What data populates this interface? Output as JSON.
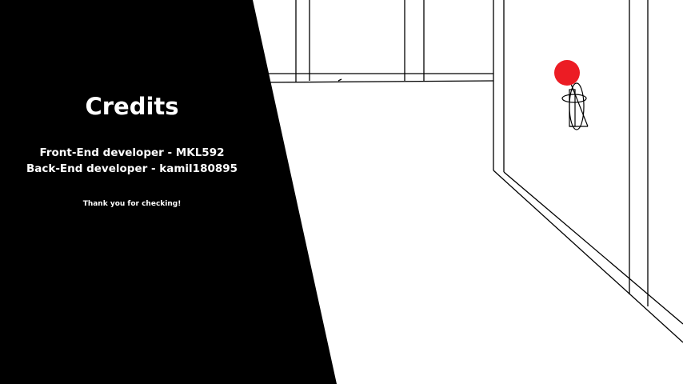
{
  "credits": {
    "title": "Credits",
    "lines": [
      "Front-End developer  -  MKL592",
      "Back-End developer  -  kamil180895"
    ],
    "thanks": "Thank you for checking!"
  },
  "colors": {
    "background": "#ffffff",
    "panel": "#000000",
    "text": "#ffffff",
    "line": "#000000",
    "target_dot": "#ec1c24"
  },
  "scene": {
    "target_icon": "red-dot-icon",
    "figure_icon": "wireframe-figure-icon"
  }
}
